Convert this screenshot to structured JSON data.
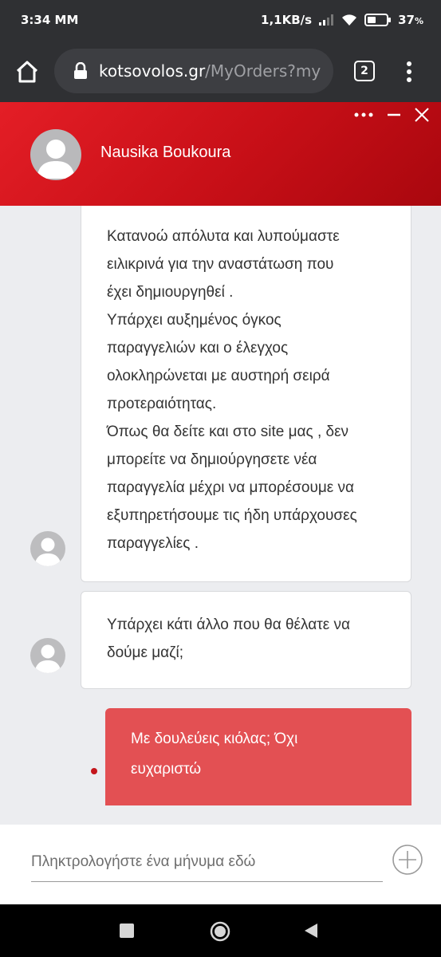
{
  "status_bar": {
    "time": "3:34 MM",
    "network_speed": "1,1KB/s",
    "battery": "37",
    "battery_unit": "%"
  },
  "browser": {
    "url_host": "kotsovolos.gr",
    "url_path": "/MyOrders?my",
    "tab_count": "2"
  },
  "chat": {
    "agent_name": "Nausika Boukoura",
    "messages": [
      {
        "from": "agent",
        "lines": [
          "Κατανοώ απόλυτα και λυπούμαστε",
          "ειλικρινά για την αναστάτωση που",
          "έχει δημιουργηθεί .",
          "Υπάρχει αυξημένος όγκος",
          "παραγγελιών και ο έλεγχος",
          "ολοκληρώνεται με αυστηρή σειρά",
          "προτεραιότητας.",
          "Όπως θα δείτε και στο site μας , δεν",
          "μπορείτε να δημιούργησετε νέα",
          "παραγγελία μέχρι να μπορέσουμε να",
          "εξυπηρετήσουμε τις ήδη υπάρχουσες",
          "παραγγελίες ."
        ]
      },
      {
        "from": "agent",
        "lines": [
          "Υπάρχει κάτι άλλο που θα θέλατε να",
          "δούμε μαζί;"
        ]
      },
      {
        "from": "user",
        "lines": [
          "Με δουλεύεις κιόλας; Όχι",
          "ευχαριστώ"
        ]
      }
    ]
  },
  "composer": {
    "placeholder": "Πληκτρολογήστε ένα μήνυμα εδώ",
    "value": ""
  },
  "colors": {
    "brand_red": "#e41e26",
    "user_bubble": "#e35053",
    "chrome_dark": "#2f3033"
  }
}
